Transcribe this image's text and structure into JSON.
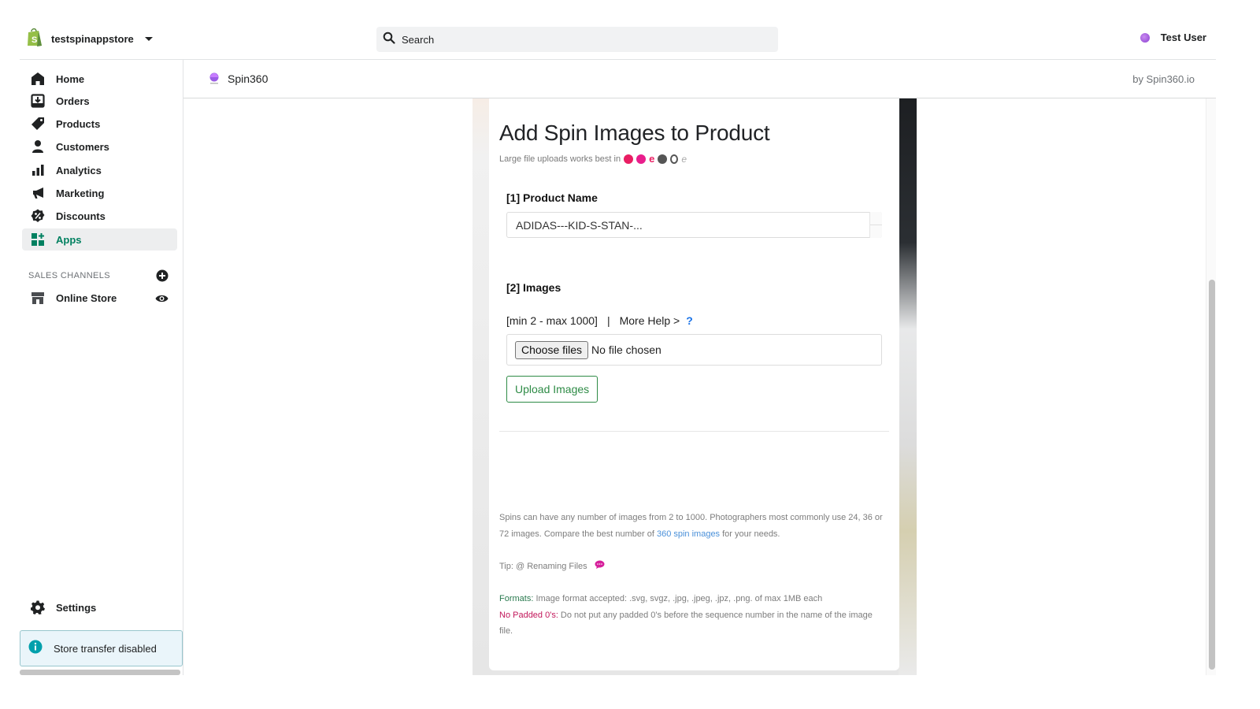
{
  "topbar": {
    "store_name": "testspinappstore",
    "search_placeholder": "Search",
    "user_name": "Test User"
  },
  "sidebar": {
    "items": [
      {
        "label": "Home",
        "icon": "home-icon"
      },
      {
        "label": "Orders",
        "icon": "orders-icon"
      },
      {
        "label": "Products",
        "icon": "tag-icon"
      },
      {
        "label": "Customers",
        "icon": "person-icon"
      },
      {
        "label": "Analytics",
        "icon": "bar-chart-icon"
      },
      {
        "label": "Marketing",
        "icon": "megaphone-icon"
      },
      {
        "label": "Discounts",
        "icon": "discount-icon"
      },
      {
        "label": "Apps",
        "icon": "apps-icon",
        "active": true
      }
    ],
    "sales_channels_title": "SALES CHANNELS",
    "online_store": "Online Store",
    "settings": "Settings",
    "store_transfer": "Store transfer disabled"
  },
  "app_header": {
    "app_name": "Spin360",
    "byline": "by Spin360.io"
  },
  "form": {
    "title": "Add Spin Images to Product",
    "browsers_text": "Large file uploads works best in",
    "browsers": [
      "chrome-icon",
      "safari-icon",
      "edge-icon",
      "firefox-icon",
      "opera-icon",
      "ie-icon"
    ],
    "product_label": "[1] Product Name",
    "product_value": "ADIDAS---KID-S-STAN-...",
    "images_label": "[2] Images",
    "range_text": "[min 2 - max 1000]",
    "separator": "|",
    "more_help": "More Help >",
    "help_q": "?",
    "choose_files": "Choose files",
    "no_file": "No file chosen",
    "upload_button": "Upload Images",
    "info_part1": "Spins can have any number of images from 2 to 1000. Photographers most commonly use 24, 36 or 72 images. Compare the best number of ",
    "info_link": "360 spin images",
    "info_part2": " for your needs.",
    "tip": "Tip: @ Renaming Files",
    "formats_key": "Formats:",
    "formats_text": " Image format accepted: .svg, svgz, .jpg, .jpeg, .jpz, .png. of max 1MB each",
    "padded_key": "No Padded 0's:",
    "padded_text": " Do not put any padded 0's before the sequence number in the name of the image file."
  },
  "colors": {
    "accent_green": "#008060",
    "upload_green": "#2e8b46",
    "pink": "#c2185b",
    "link_blue": "#4a90d9"
  }
}
